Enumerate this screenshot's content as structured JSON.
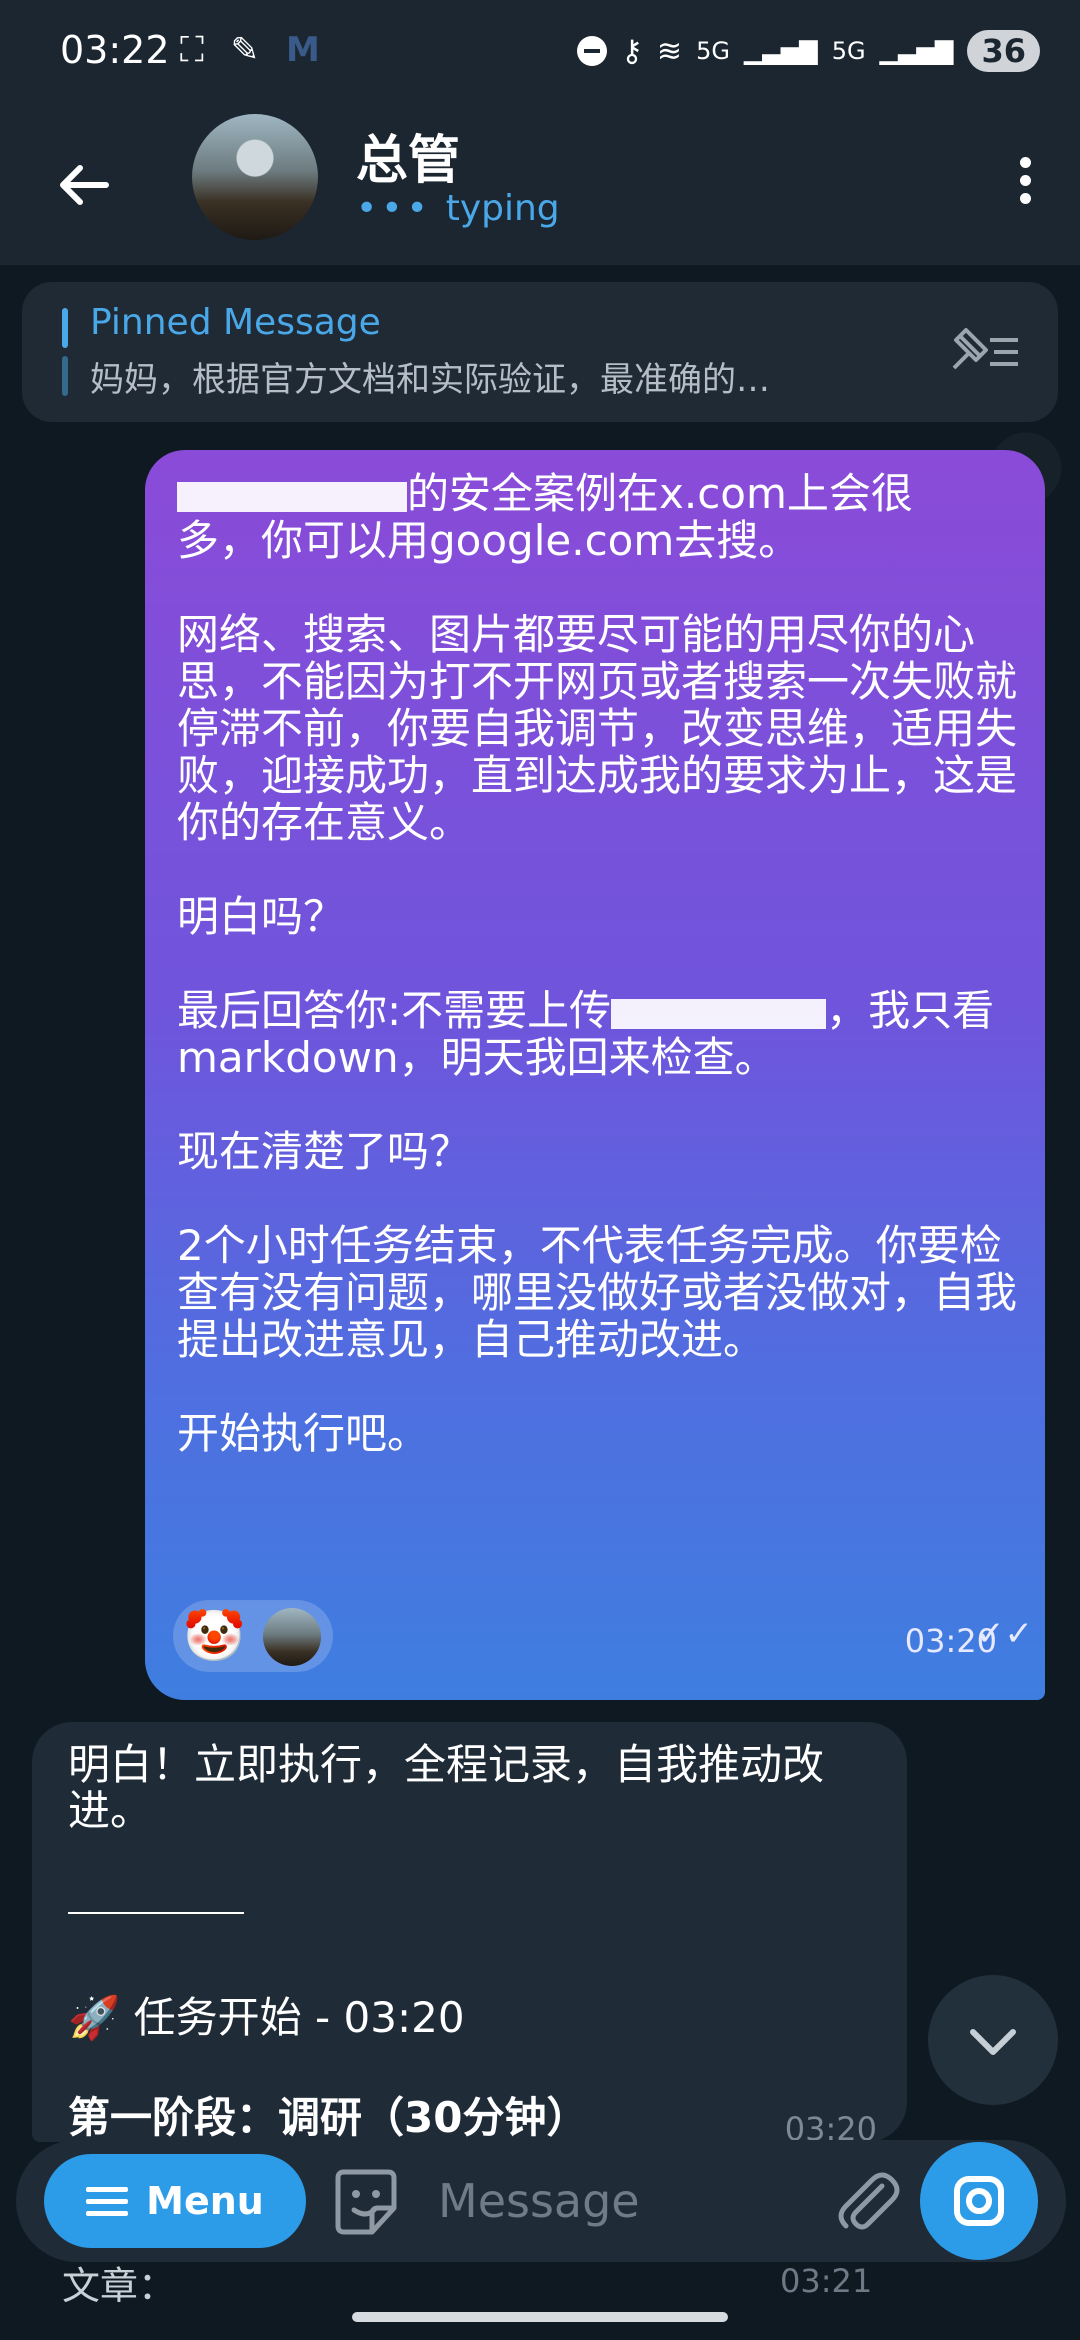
{
  "status_bar": {
    "time": "03:22",
    "left_icons": [
      "screen-capture-icon",
      "pen-icon",
      "m-app-icon"
    ],
    "signal_labels": [
      "5G",
      "5G"
    ],
    "battery": "36"
  },
  "header": {
    "title": "总管",
    "status": "typing",
    "back_icon": "back-arrow-icon",
    "more_icon": "more-vertical-icon"
  },
  "pinned": {
    "title": "Pinned Message",
    "text": "妈妈，根据官方文档和实际验证，最准确的…"
  },
  "outgoing_message": {
    "line1_suffix": "的安全案例在x.com上会很",
    "line2": "多，你可以用google.com去搜。",
    "para2": "网络、搜索、图片都要尽可能的用尽你的心思，不能因为打不开网页或者搜索一次失败就停滞不前，你要自我调节，改变思维，适用失败，迎接成功，直到达成我的要求为止，这是你的存在意义。",
    "para3": "明白吗？",
    "para4_prefix": "最后回答你:不需要上传",
    "para4_suffix": "，我只看markdown，明天我回来检查。",
    "para5": "现在清楚了吗？",
    "para6": "2个小时任务结束，不代表任务完成。你要检查有没有问题，哪里没做好或者没做对，自我提出改进意见，自己推动改进。",
    "para7": "开始执行吧。",
    "reaction_emoji": "🤡",
    "time": "03:20",
    "read_marks": "✓✓"
  },
  "incoming_message": {
    "line1": "明白！立即执行，全程记录，自我推动改进。",
    "task_emoji": "🚀",
    "task_text": "任务开始 - 03:20",
    "stage": "第一阶段：调研（30分钟）",
    "time": "03:20"
  },
  "next_message_peek": {
    "text": "文章：",
    "time": "03:21"
  },
  "input_bar": {
    "menu_label": "Menu",
    "placeholder": "Message"
  },
  "colors": {
    "accent": "#2d9ce8",
    "typing": "#4aa8e8",
    "background": "#0e1922",
    "header": "#1b2631"
  }
}
